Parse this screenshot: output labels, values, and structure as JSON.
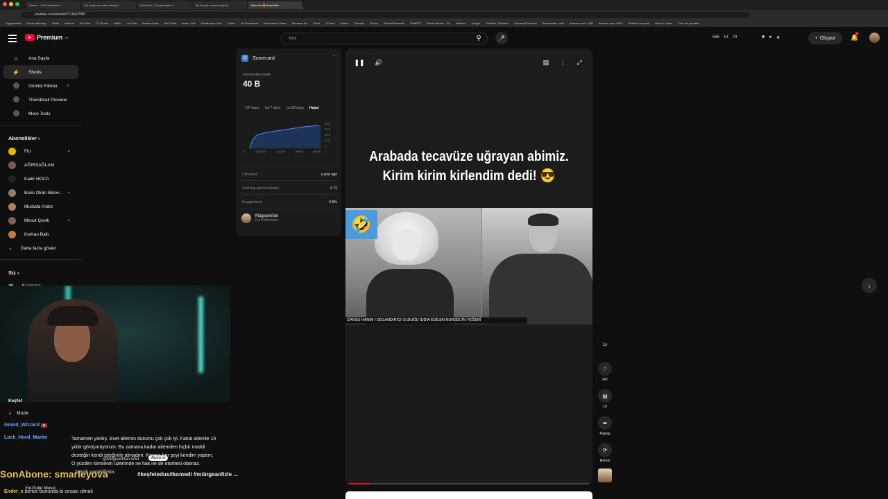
{
  "browser": {
    "tabs": [
      "Stream - Kick Dashboard",
      "(6) müge anlı adam fıtkraj ü",
      "(6) Atıcam, 20 yaşındaki av",
      "(6) Sosyal medyada görüş",
      "kirlendim😎#keşfet#ke"
    ],
    "url": "youtube.com/shorts/2Y1kRd7IB0",
    "bookmarks": [
      "Uygulamalar",
      "Sonar Şahinkay",
      "Gmail",
      "Hotmail",
      "YouTube",
      "YT Studio",
      "Netflix",
      "Ye Chat",
      "featured chat",
      "Kick Chat",
      "sonar | kick",
      "Dashboard / kick",
      "Twitch",
      "Ye Dashboard",
      "Dashboard / Strea",
      "Streamer Ad",
      "Çeviri",
      "CCloud",
      "Twitter",
      "Threads",
      "Ozzius",
      "StreamElements",
      "ChatGPT",
      "Radio Garden - Kh",
      "Adfense",
      "Google",
      "Portfolio | Shutters",
      "Universal Producti",
      "Streamable - vide",
      "Amazon.com: USB",
      "Amazon.com: KIOV",
      "Submit a request",
      "Drive & Listen",
      "Tüm Yer İşaretleri"
    ]
  },
  "header": {
    "logo_text": "Premium",
    "logo_sup": "TR",
    "search_placeholder": "Ara",
    "stats": [
      "565",
      "14",
      "79"
    ],
    "create_label": "Oluştur",
    "notif_count": "9"
  },
  "sidebar": {
    "items": [
      {
        "label": "Ana Sayfa",
        "icon": "home-icon"
      },
      {
        "label": "Shorts",
        "icon": "shorts-icon"
      },
      {
        "label": "Günlük Fikirler",
        "icon": "circle-icon"
      },
      {
        "label": "Thumbnail Preview",
        "icon": "circle-icon"
      },
      {
        "label": "More Tools",
        "icon": "circle-icon"
      }
    ],
    "subs_heading": "Abonelikler",
    "subs": [
      {
        "label": "Flu",
        "color": "#e8b400"
      },
      {
        "label": "AĞIRSAĞLAM",
        "color": "#7a5a4a"
      },
      {
        "label": "Kadir HOCA",
        "color": "#222222"
      },
      {
        "label": "Baris Okan Belov...",
        "color": "#9a7a6a"
      },
      {
        "label": "Mustafa Yıldız",
        "color": "#b08060"
      },
      {
        "label": "Mesut Çevik",
        "color": "#806050"
      },
      {
        "label": "Korhan Ballı",
        "color": "#c08040"
      }
    ],
    "more_label": "Daha fazla göster",
    "you_heading": "Siz",
    "you_items": [
      {
        "label": "Kanalınız"
      }
    ],
    "explore_label": "Keşfet",
    "music_label": "Müzik",
    "yt_music_label": "YouTube Music"
  },
  "scorecard": {
    "title": "Scorecard",
    "views_label": "Görüntülenmeler",
    "views_value": "40 B",
    "tabs": [
      "24 hours",
      "1st 7 days",
      "1st 28 days",
      "Hepsi"
    ],
    "active_tab": "Hepsi",
    "chart": {
      "x_labels": [
        "0",
        "10/22/25",
        "11/3/25",
        "3/9/26",
        "8/6/26"
      ],
      "y_labels": [
        "40 B",
        "30 B",
        "20 B",
        "10 B",
        "0"
      ]
    },
    "rows": [
      {
        "label": "Uploaded",
        "value": "a year ago"
      },
      {
        "label": "Saat başı görüntülenme",
        "value": "0.72"
      },
      {
        "label": "Engagement",
        "value": "0.6%"
      }
    ],
    "channel_name": "Mügeanlıfan",
    "channel_subs": "5,4 B Aboneler"
  },
  "player": {
    "caption_line1": "Arabada tecavüze uğrayan abimiz.",
    "caption_line2": "Kirim kirim kirlendim dedi! 😎",
    "ticker": "CANSU HANIM / DOLANDIRICI OLDUĞU İDDİA EDİLEN NURSEL'İN YEĞENİ"
  },
  "actions": {
    "speed": "1x",
    "likes": "247",
    "comments": "10",
    "share_label": "Paylaş",
    "remix_label": "Remix"
  },
  "chat": {
    "messages": [
      {
        "user": "Grand_Wizzard",
        "text": ""
      },
      {
        "user": "Lock_Heed_Martin",
        "text": "Tamamen yanlış. Evet ailemin durumu çok çok iyi. Fakat ailemle 10 yıldır görüşmüyorum. Bu zamana kadar ailemden hiçbir maddi desteğin kendi isteğimle almadım. Kısaca her şeyi kendim yaptım. O yüzden kimsenin üzerimde ne hak ne de otoritesi olamaz. ...büyük yapabilirsin."
      },
      {
        "user": "Ender_x",
        "text": "bence bununda bi cezası olmalı"
      }
    ],
    "overlay_user": "SonAbone: smarleyova",
    "overlay_desc": "#keşfetedus#komedi #müngeanlizle ...",
    "handle": "@Mügeanlıfan-w5d",
    "subscribe_chip": "Abone ol"
  }
}
